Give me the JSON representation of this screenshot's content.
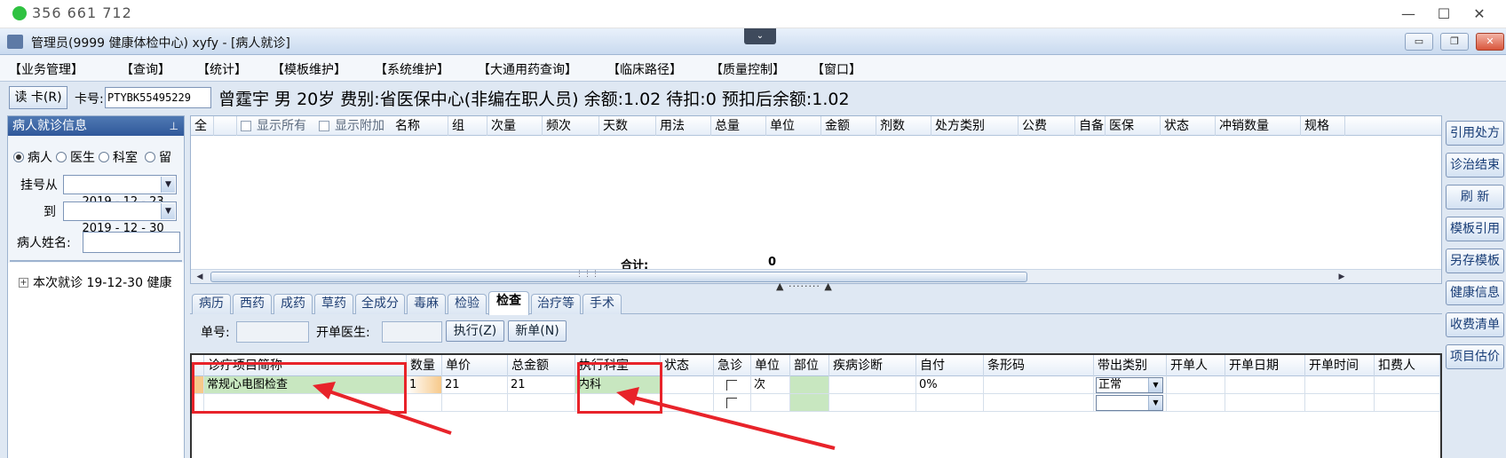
{
  "remote": {
    "id": "356 661 712",
    "min": "—",
    "max": "☐",
    "close": "✕",
    "dot_color": "#2fc241"
  },
  "window": {
    "title": "管理员(9999 健康体检中心) xyfy - [病人就诊]",
    "drop": "⌄",
    "min": "▭",
    "restore": "❐",
    "close": "✕"
  },
  "menu": [
    "【业务管理】",
    "【查询】",
    "【统计】",
    "【模板维护】",
    "【系统维护】",
    "【大通用药查询】",
    "【临床路径】",
    "【质量控制】",
    "【窗口】"
  ],
  "patient": {
    "read_card": "读 卡(R)",
    "card_label": "卡号:",
    "card_no": "PTYBK55495229",
    "info": "曾霆宇 男 20岁 费别:省医保中心(非编在职人员) 余额:1.02 待扣:0 预扣后余额:1.02"
  },
  "left": {
    "header": "病人就诊信息",
    "pin": "⊥",
    "radios": [
      {
        "label": "病人",
        "checked": true
      },
      {
        "label": "医生",
        "checked": false
      },
      {
        "label": "科室",
        "checked": false
      },
      {
        "label": "留",
        "checked": false
      }
    ],
    "reg_from_label": "挂号从",
    "reg_from": "2019 - 12 - 23",
    "reg_to_label": "到",
    "reg_to": "2019 - 12 - 30",
    "name_label": "病人姓名:",
    "name_value": "",
    "tree_item": "本次就诊 19-12-30 健康",
    "tree_expand": "+"
  },
  "upper_grid": {
    "headers": [
      "全",
      "",
      "显示所有",
      "显示附加",
      "名称",
      "组",
      "次量",
      "频次",
      "天数",
      "用法",
      "总量",
      "单位",
      "金额",
      "剂数",
      "处方类别",
      "公费",
      "自备",
      "医保",
      "状态",
      "冲销数量",
      "规格"
    ],
    "total_label": "合计:",
    "total_value": "0",
    "scroll_left": "◀",
    "scroll_right": "▶",
    "grip": "⋮⋮⋮",
    "splitter": "▲ ········ ▲"
  },
  "tabs": [
    "病历",
    "西药",
    "成药",
    "草药",
    "全成分",
    "毒麻",
    "检验",
    "检查",
    "治疗等",
    "手术"
  ],
  "active_tab": "检查",
  "lower_toolbar": {
    "order_no_label": "单号:",
    "doctor_label": "开单医生:",
    "execute_btn": "执行(Z)",
    "new_btn": "新单(N)"
  },
  "lower_grid": {
    "headers": [
      "诊疗项目简称",
      "数量",
      "单价",
      "总金额",
      "执行科室",
      "状态",
      "急诊",
      "单位",
      "部位",
      "疾病诊断",
      "自付",
      "条形码",
      "带出类别",
      "开单人",
      "开单日期",
      "开单时间",
      "扣费人"
    ],
    "rows": [
      {
        "name": "常规心电图检查",
        "qty": "1",
        "price": "21",
        "total": "21",
        "dept": "内科",
        "status": "",
        "unit": "次",
        "self_pay": "0%",
        "category": "正常"
      },
      {
        "name": "",
        "qty": "",
        "price": "",
        "total": "",
        "dept": "",
        "status": "",
        "unit": "",
        "self_pay": "",
        "category": ""
      }
    ],
    "combo_arrow": "▼"
  },
  "right_buttons": [
    "引用处方",
    "诊治结束",
    "刷 新",
    "模板引用",
    "另存模板",
    "健康信息",
    "收费清单",
    "项目估价"
  ],
  "colors": {
    "annotation_red": "#e8232a",
    "highlight_green": "#c8e7c0",
    "header_blue": "#30589a"
  }
}
